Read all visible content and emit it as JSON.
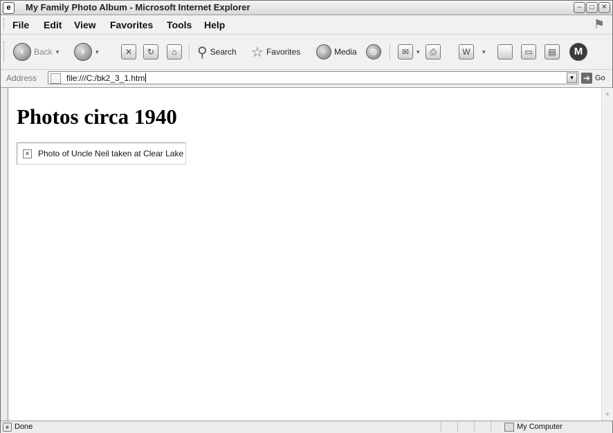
{
  "window": {
    "title": "My Family Photo Album - Microsoft Internet Explorer",
    "controls": [
      "minimize",
      "maximize",
      "close"
    ]
  },
  "menu": {
    "items": [
      "File",
      "Edit",
      "View",
      "Favorites",
      "Tools",
      "Help"
    ]
  },
  "toolbar": {
    "back_label": "Back",
    "search_label": "Search",
    "favorites_label": "Favorites",
    "media_label": "Media"
  },
  "address": {
    "label": "Address",
    "url": "file:///C:/bk2_3_1.htm",
    "go_label": "Go"
  },
  "page": {
    "heading": "Photos circa 1940",
    "image_alt": "Photo of Uncle Neil taken at Clear Lake"
  },
  "status": {
    "text": "Done",
    "zone": "My Computer"
  }
}
